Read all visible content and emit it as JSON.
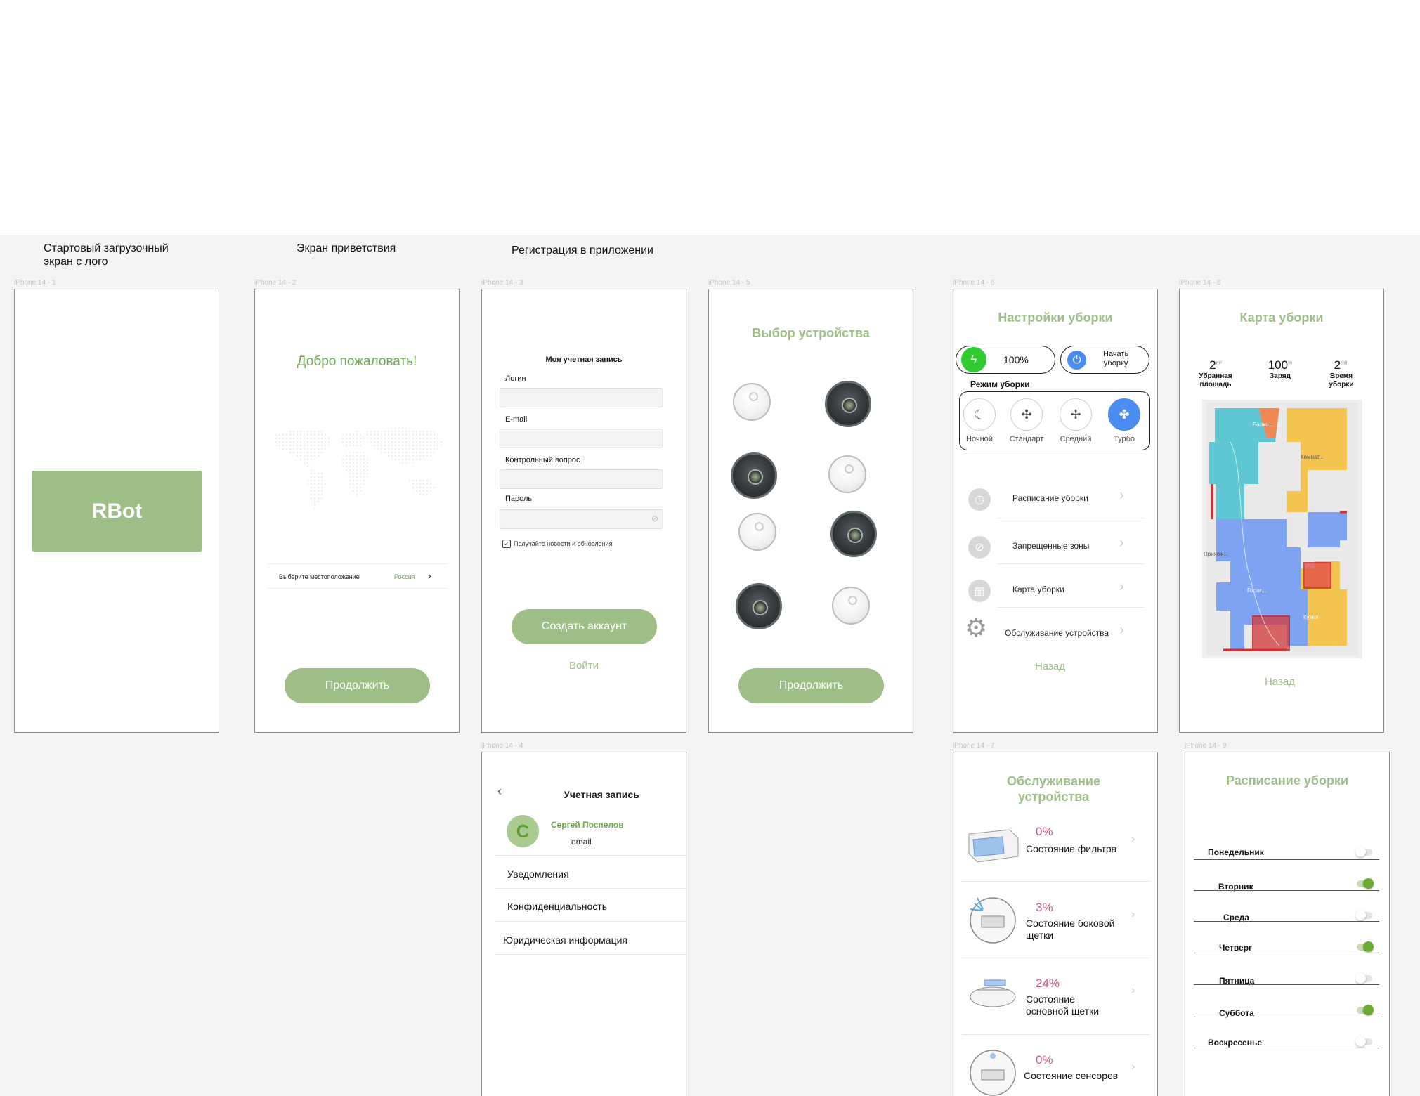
{
  "captions": {
    "start": "Стартовый загрузочный\nэкран с лого",
    "welcome": "Экран приветствия",
    "registration": "Регистрация в приложении"
  },
  "frame_labels": [
    "iPhone 14 - 1",
    "iPhone 14 - 2",
    "iPhone 14 - 3",
    "iPhone 14 - 5",
    "iPhone 14 - 6",
    "iPhone 14 - 8",
    "iPhone 14 - 4",
    "iPhone 14 - 7",
    "iPhone 14 - 9"
  ],
  "splash": {
    "logo": "RBot"
  },
  "welcome": {
    "title": "Добро пожаловать!",
    "location_label": "Выберите местоположение",
    "location_value": "Россия",
    "continue": "Продолжить"
  },
  "register": {
    "title": "Моя учетная запись",
    "login": "Логин",
    "email": "E-mail",
    "question": "Контрольный вопрос",
    "password": "Пароль",
    "newsletter": "Получайте новости и обновления",
    "create": "Создать аккаунт",
    "signin": "Войти"
  },
  "device": {
    "title": "Выбор устройства",
    "continue": "Продолжить"
  },
  "settings": {
    "title": "Настройки уборки",
    "battery": "100%",
    "start_line1": "Начать",
    "start_line2": "уборку",
    "modes_title": "Режим уборки",
    "modes": [
      "Ночной",
      "Стандарт",
      "Средний",
      "Турбо"
    ],
    "menu": [
      "Расписание уборки",
      "Запрещенные зоны",
      "Карта уборки",
      "Обслуживание устройства"
    ],
    "back": "Назад"
  },
  "map": {
    "title": "Карта уборки",
    "stats": [
      {
        "value": "2",
        "unit": "m²",
        "label": "Убранная\nплощадь"
      },
      {
        "value": "100",
        "unit": "%",
        "label": "Заряд"
      },
      {
        "value": "2",
        "unit": "min",
        "label": "Время\nуборки"
      }
    ],
    "rooms": [
      "Балко...",
      "Комнат...",
      "Прихож...",
      "Гости...",
      "Кухня"
    ],
    "back": "Назад"
  },
  "account": {
    "title": "Учетная запись",
    "initial": "С",
    "name": "Сергей Поспелов",
    "email": "email",
    "items": [
      "Уведомления",
      "Конфиденциальность",
      "Юридическая информация"
    ]
  },
  "service": {
    "title_line1": "Обслуживание",
    "title_line2": "устройства",
    "items": [
      {
        "percent": "0%",
        "label": "Состояние фильтра"
      },
      {
        "percent": "3%",
        "label": "Состояние боковой\nщетки"
      },
      {
        "percent": "24%",
        "label": "Состояние\nосновной щетки"
      },
      {
        "percent": "0%",
        "label": "Состояние сенсоров"
      }
    ]
  },
  "schedule": {
    "title": "Расписание уборки",
    "days": [
      {
        "name": "Понедельник",
        "on": false
      },
      {
        "name": "Вторник",
        "on": true
      },
      {
        "name": "Среда",
        "on": false
      },
      {
        "name": "Четверг",
        "on": true
      },
      {
        "name": "Пятница",
        "on": false
      },
      {
        "name": "Суббота",
        "on": true
      },
      {
        "name": "Воскресенье",
        "on": false
      }
    ]
  },
  "colors": {
    "brand_green": "#9dbf87",
    "title_green": "#6aa84f",
    "accent_blue": "#4a8cf0",
    "battery_green": "#2ecc2e",
    "warn_pink": "#c85a7a"
  }
}
